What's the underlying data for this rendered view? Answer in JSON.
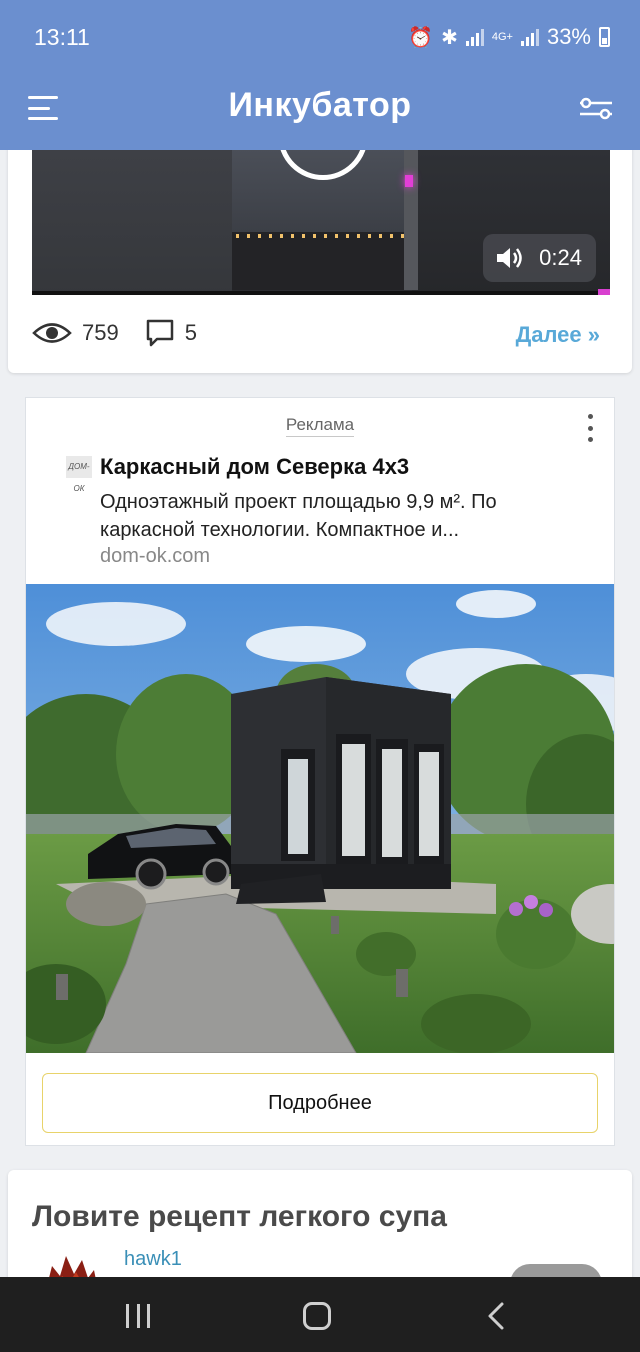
{
  "status_bar": {
    "time": "13:11",
    "network": "4G+",
    "battery": "33%"
  },
  "header": {
    "title": "Инкубатор",
    "menu_icon": "hamburger-menu-icon",
    "filter_icon": "filter-sliders-icon",
    "background_color": "#6b8fcf"
  },
  "post": {
    "video_duration": "0:24",
    "views": "759",
    "comments": "5",
    "more_link": "Далее »"
  },
  "ad": {
    "label": "Реклама",
    "logo_text": "ДОМ-ОК",
    "title": "Каркасный дом Северка 4х3",
    "description": "Одноэтажный проект площадью 9,9 м². По каркасной технологии. Компактное и...",
    "url": "dom-ok.com",
    "button_label": "Подробнее",
    "button_border_color": "#e8d36a"
  },
  "next_post": {
    "title": "Ловите рецепт легкого супа",
    "author": "hawk1"
  },
  "nav_bar": {
    "recent_icon": "recent-apps-icon",
    "home_icon": "home-icon",
    "back_icon": "back-icon"
  }
}
